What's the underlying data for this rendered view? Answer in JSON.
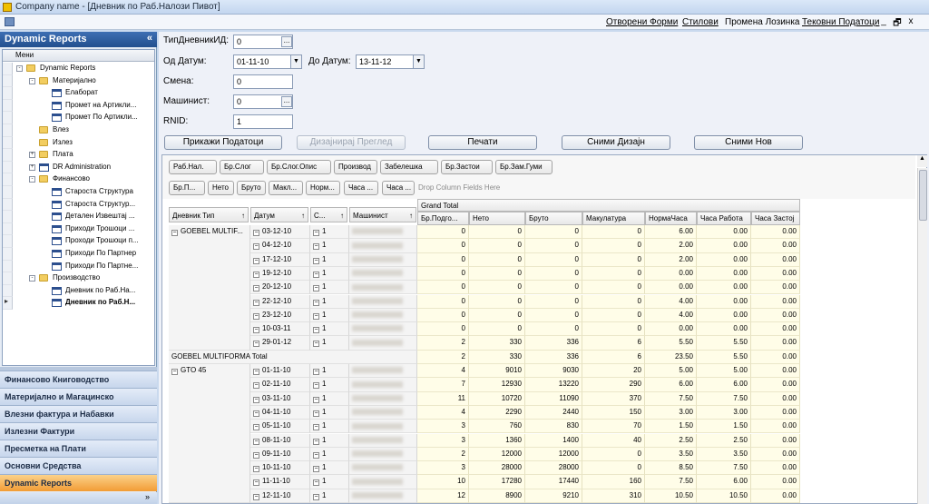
{
  "window": {
    "title": "Company name - [Дневник по Раб.Налози Пивот]"
  },
  "menu": {
    "items": [
      "Отворени Форми",
      "Стилови",
      "Промена Лозинка",
      "Тековни Податоци"
    ],
    "win_controls": [
      "_",
      "🗗",
      "x"
    ]
  },
  "nav": {
    "title": "Dynamic Reports",
    "collapse": "«",
    "tree_header": "Мени",
    "tree": [
      {
        "label": "Dynamic Reports",
        "kind": "folder",
        "exp": "-",
        "level": 0
      },
      {
        "label": "Материјално",
        "kind": "folder",
        "exp": "-",
        "level": 1
      },
      {
        "label": "Елаборат",
        "kind": "report",
        "level": 2
      },
      {
        "label": "Промет на Артикли...",
        "kind": "report",
        "level": 2
      },
      {
        "label": "Промет По Артикли...",
        "kind": "report",
        "level": 2
      },
      {
        "label": "Влез",
        "kind": "folder",
        "level": 1
      },
      {
        "label": "Излез",
        "kind": "folder",
        "level": 1
      },
      {
        "label": "Плата",
        "kind": "folder",
        "exp": "+",
        "level": 1
      },
      {
        "label": "DR Administration",
        "kind": "report",
        "exp": "+",
        "level": 1
      },
      {
        "label": "Финансово",
        "kind": "folder",
        "exp": "-",
        "level": 1
      },
      {
        "label": "Староста Структура",
        "kind": "report",
        "level": 2
      },
      {
        "label": "Староста Структур...",
        "kind": "report",
        "level": 2
      },
      {
        "label": "Детален Извештај ...",
        "kind": "report",
        "level": 2
      },
      {
        "label": "Приходи Трошоци ...",
        "kind": "report",
        "level": 2
      },
      {
        "label": "Проходи Трошоци п...",
        "kind": "report",
        "level": 2
      },
      {
        "label": "Приходи По Партнер",
        "kind": "report",
        "level": 2
      },
      {
        "label": "Приходи По Партне...",
        "kind": "report",
        "level": 2
      },
      {
        "label": "Производство",
        "kind": "folder",
        "exp": "-",
        "level": 1
      },
      {
        "label": "Дневник по Раб.На...",
        "kind": "report",
        "level": 2
      },
      {
        "label": "Дневник по Раб.Н...",
        "kind": "report",
        "level": 2,
        "bold": true,
        "current": true
      }
    ],
    "bars": [
      "Финансово Книговодство",
      "Материјално и Магацинско",
      "Влезни фактура и Набавки",
      "Излезни Фактури",
      "Пресметка на Плати",
      "Основни Средства",
      "Dynamic Reports"
    ],
    "bottom_chevron": "»"
  },
  "form": {
    "tip_label": "ТипДневникИД:",
    "tip_value": "0",
    "od_label": "Од Датум:",
    "od_value": "01-11-10",
    "do_label": "До Датум:",
    "do_value": "13-11-12",
    "smena_label": "Смена:",
    "smena_value": "0",
    "masinist_label": "Машинист:",
    "masinist_value": "0",
    "rnid_label": "RNID:",
    "rnid_value": "1",
    "ellipsis": "...",
    "dropdown": "▼"
  },
  "buttons": {
    "show": "Прикажи Податоци",
    "design": "Дизајнирај Преглед",
    "print": "Печати",
    "save_design": "Сними Дизајн",
    "save_new": "Сними Нов"
  },
  "pivot": {
    "filter_row1": [
      "Раб.Нал.",
      "Бр.Слог",
      "Бр.Слог.Опис",
      "Производ",
      "Забелешка",
      "Бр.Застои",
      "Бр.Зам.Гуми"
    ],
    "filter_row2": [
      "Бр.П...",
      "Нето",
      "Бруто",
      "Макл...",
      "Норм...",
      "Часа ...",
      "Часа ..."
    ],
    "drop_hint": "Drop Column Fields Here",
    "grand_total": "Grand Total",
    "row_fields": [
      "Дневник Тип",
      "Датум",
      "С...",
      "Машинист"
    ],
    "sort_arrow": "↑",
    "data_cols": [
      "Бр.Подго...",
      "Нето",
      "Бруто",
      "Макулатура",
      "НормаЧаса",
      "Часа Работа",
      "Часа Застој"
    ],
    "groups": [
      {
        "name": "GOEBEL MULTIF...",
        "total_label": "GOEBEL MULTIFORMA Total",
        "rows": [
          {
            "date": "03-12-10",
            "s": "1",
            "v": [
              "0",
              "0",
              "0",
              "0",
              "6.00",
              "0.00",
              "0.00"
            ]
          },
          {
            "date": "04-12-10",
            "s": "1",
            "v": [
              "0",
              "0",
              "0",
              "0",
              "2.00",
              "0.00",
              "0.00"
            ]
          },
          {
            "date": "17-12-10",
            "s": "1",
            "v": [
              "0",
              "0",
              "0",
              "0",
              "2.00",
              "0.00",
              "0.00"
            ]
          },
          {
            "date": "19-12-10",
            "s": "1",
            "v": [
              "0",
              "0",
              "0",
              "0",
              "0.00",
              "0.00",
              "0.00"
            ]
          },
          {
            "date": "20-12-10",
            "s": "1",
            "v": [
              "0",
              "0",
              "0",
              "0",
              "0.00",
              "0.00",
              "0.00"
            ]
          },
          {
            "date": "22-12-10",
            "s": "1",
            "v": [
              "0",
              "0",
              "0",
              "0",
              "4.00",
              "0.00",
              "0.00"
            ]
          },
          {
            "date": "23-12-10",
            "s": "1",
            "v": [
              "0",
              "0",
              "0",
              "0",
              "4.00",
              "0.00",
              "0.00"
            ]
          },
          {
            "date": "10-03-11",
            "s": "1",
            "v": [
              "0",
              "0",
              "0",
              "0",
              "0.00",
              "0.00",
              "0.00"
            ]
          },
          {
            "date": "29-01-12",
            "s": "1",
            "v": [
              "2",
              "330",
              "336",
              "6",
              "5.50",
              "5.50",
              "0.00"
            ]
          }
        ],
        "total": [
          "2",
          "330",
          "336",
          "6",
          "23.50",
          "5.50",
          "0.00"
        ]
      },
      {
        "name": "GTO 45",
        "rows": [
          {
            "date": "01-11-10",
            "s": "1",
            "v": [
              "4",
              "9010",
              "9030",
              "20",
              "5.00",
              "5.00",
              "0.00"
            ]
          },
          {
            "date": "02-11-10",
            "s": "1",
            "v": [
              "7",
              "12930",
              "13220",
              "290",
              "6.00",
              "6.00",
              "0.00"
            ]
          },
          {
            "date": "03-11-10",
            "s": "1",
            "v": [
              "11",
              "10720",
              "11090",
              "370",
              "7.50",
              "7.50",
              "0.00"
            ]
          },
          {
            "date": "04-11-10",
            "s": "1",
            "v": [
              "4",
              "2290",
              "2440",
              "150",
              "3.00",
              "3.00",
              "0.00"
            ]
          },
          {
            "date": "05-11-10",
            "s": "1",
            "v": [
              "3",
              "760",
              "830",
              "70",
              "1.50",
              "1.50",
              "0.00"
            ]
          },
          {
            "date": "08-11-10",
            "s": "1",
            "v": [
              "3",
              "1360",
              "1400",
              "40",
              "2.50",
              "2.50",
              "0.00"
            ]
          },
          {
            "date": "09-11-10",
            "s": "1",
            "v": [
              "2",
              "12000",
              "12000",
              "0",
              "3.50",
              "3.50",
              "0.00"
            ]
          },
          {
            "date": "10-11-10",
            "s": "1",
            "v": [
              "3",
              "28000",
              "28000",
              "0",
              "8.50",
              "7.50",
              "0.00"
            ]
          },
          {
            "date": "11-11-10",
            "s": "1",
            "v": [
              "10",
              "17280",
              "17440",
              "160",
              "7.50",
              "6.00",
              "0.00"
            ]
          },
          {
            "date": "12-11-10",
            "s": "1",
            "v": [
              "12",
              "8900",
              "9210",
              "310",
              "10.50",
              "10.50",
              "0.00"
            ]
          }
        ]
      }
    ]
  }
}
